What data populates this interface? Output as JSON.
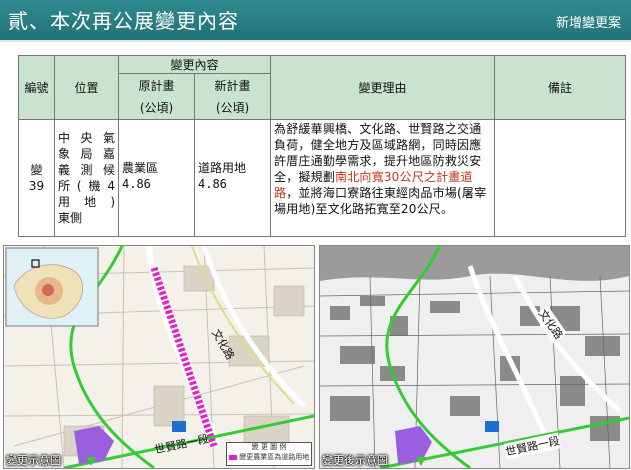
{
  "header": {
    "title": "貳、本次再公展變更內容",
    "right_label": "新增變更案"
  },
  "table": {
    "group_header": "變更內容",
    "col_number": "編號",
    "col_location": "位置",
    "col_original": "原計畫",
    "col_new": "新計畫",
    "unit": "(公頃)",
    "col_reason": "變更理由",
    "col_remarks": "備註",
    "row": {
      "number": "變\n39",
      "location_lines": [
        "中央氣",
        "象局嘉",
        "義測候",
        "所(機4",
        "用地)",
        "東側"
      ],
      "original_name": "農業區",
      "original_value": "4.86",
      "new_name": "道路用地",
      "new_value": "4.86",
      "reason_part1": "為舒緩華興橋、文化路、世賢路之交通負荷，健全地方及區域路網，同時因應許厝庄通勤學需求，提升地區防救災安全，擬規劃",
      "reason_red": "南北向寬30公尺之計畫道路",
      "reason_part2": "，並將海口寮路往東經肉品市場(屠宰場用地)至文化路拓寬至20公尺。",
      "remarks": ""
    }
  },
  "maps": {
    "left_caption": "變更示意圖",
    "right_caption": "變更後示意圖",
    "road_culture": "文化路",
    "road_shixian": "世賢路一段",
    "legend_title": "變 更 圖 例",
    "legend_item": "變更農業區為道路用地"
  },
  "colors": {
    "header_bg": "#2a7f84",
    "table_header_bg": "#c9e3cf",
    "reason_highlight": "#c8321c",
    "road_green": "#33cc33",
    "change_magenta": "#e020c8",
    "zone_purple": "#9a5fe0",
    "zone_blue": "#1f6fd0"
  }
}
